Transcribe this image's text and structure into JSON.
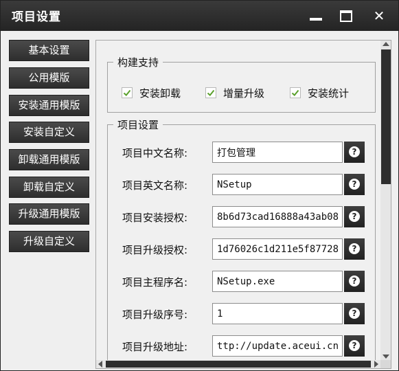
{
  "window": {
    "title": "项目设置"
  },
  "titlebar_icons": [
    "minimize-icon",
    "maximize-icon",
    "close-icon"
  ],
  "sidebar": {
    "items": [
      {
        "label": "基本设置"
      },
      {
        "label": "公用模版"
      },
      {
        "label": "安装通用模版"
      },
      {
        "label": "安装自定义"
      },
      {
        "label": "卸载通用模版"
      },
      {
        "label": "卸载自定义"
      },
      {
        "label": "升级通用模版"
      },
      {
        "label": "升级自定义"
      }
    ]
  },
  "build_support": {
    "title": "构建支持",
    "options": [
      {
        "label": "安装卸载",
        "checked": true
      },
      {
        "label": "增量升级",
        "checked": true
      },
      {
        "label": "安装统计",
        "checked": true
      }
    ]
  },
  "project_settings": {
    "title": "项目设置",
    "fields": [
      {
        "label": "项目中文名称:",
        "value": "打包管理"
      },
      {
        "label": "项目英文名称:",
        "value": "NSetup"
      },
      {
        "label": "项目安装授权:",
        "value": "8b6d73cad16888a43ab08"
      },
      {
        "label": "项目升级授权:",
        "value": "1d76026c1d211e5f87728"
      },
      {
        "label": "项目主程序名:",
        "value": "NSetup.exe"
      },
      {
        "label": "项目升级序号:",
        "value": "1"
      },
      {
        "label": "项目升级地址:",
        "value": "ttp://update.aceui.cn"
      }
    ]
  },
  "colors": {
    "titlebar": "#2a2a2a",
    "button": "#333333",
    "check": "#5aa02c"
  }
}
